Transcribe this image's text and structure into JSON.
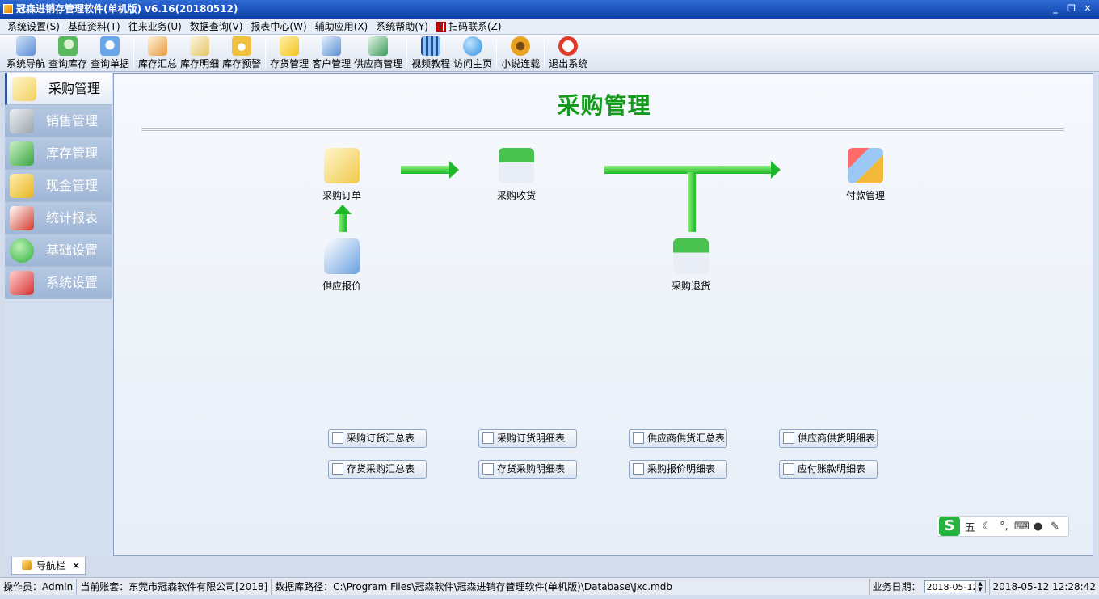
{
  "window": {
    "title": "冠森进销存管理软件(单机版) v6.16(20180512)"
  },
  "menu": [
    "系统设置(S)",
    "基础资料(T)",
    "往来业务(U)",
    "数据查询(V)",
    "报表中心(W)",
    "辅助应用(X)",
    "系统帮助(Y)",
    "扫码联系(Z)"
  ],
  "toolbar": [
    {
      "label": "系统导航",
      "icon": "computer-icon",
      "color": "#5b8fd9"
    },
    {
      "label": "查询库存",
      "icon": "magnifier-icon",
      "color": "#58b85c"
    },
    {
      "label": "查询单据",
      "icon": "search-doc-icon",
      "color": "#6aa6e8"
    },
    {
      "label": "库存汇总",
      "icon": "chart-doc-icon",
      "color": "#e89a3a"
    },
    {
      "label": "库存明细",
      "icon": "files-icon",
      "color": "#e3c36b"
    },
    {
      "label": "库存预警",
      "icon": "alarm-doc-icon",
      "color": "#f0c040"
    },
    {
      "label": "存货管理",
      "icon": "box-icon",
      "color": "#f3c21f"
    },
    {
      "label": "客户管理",
      "icon": "customer-card-icon",
      "color": "#5a8fd0"
    },
    {
      "label": "供应商管理",
      "icon": "supplier-card-icon",
      "color": "#3b9a5a"
    },
    {
      "label": "视频教程",
      "icon": "film-icon",
      "color": "#3a7fd4"
    },
    {
      "label": "访问主页",
      "icon": "globe-icon",
      "color": "#2f8fe0"
    },
    {
      "label": "小说连载",
      "icon": "sunflower-icon",
      "color": "#e9a21f"
    },
    {
      "label": "退出系统",
      "icon": "stop-icon",
      "color": "#e23a2a"
    }
  ],
  "sidebar": [
    {
      "label": "采购管理",
      "icon": "shopping-bag-icon",
      "color": "#f2d060",
      "active": true
    },
    {
      "label": "销售管理",
      "icon": "cash-register-icon",
      "color": "#9aa4ad",
      "active": false
    },
    {
      "label": "库存管理",
      "icon": "house-icon",
      "color": "#3aa53f",
      "active": false
    },
    {
      "label": "现金管理",
      "icon": "coins-icon",
      "color": "#e8b420",
      "active": false
    },
    {
      "label": "统计报表",
      "icon": "report-chart-icon",
      "color": "#d33a2a",
      "active": false
    },
    {
      "label": "基础设置",
      "icon": "check-icon",
      "color": "#2fae3a",
      "active": false
    },
    {
      "label": "系统设置",
      "icon": "wrench-icon",
      "color": "#d83030",
      "active": false
    }
  ],
  "main": {
    "title": "采购管理",
    "nodes": [
      {
        "label": "采购订单",
        "icon": "order-bag-icon",
        "color": "#f0c84a"
      },
      {
        "label": "采购收货",
        "icon": "receive-house-icon",
        "color": "#35a83c"
      },
      {
        "label": "付款管理",
        "icon": "payment-card-icon",
        "color": "#f2b93a"
      },
      {
        "label": "供应报价",
        "icon": "quote-doc-icon",
        "color": "#6aa0e0"
      },
      {
        "label": "采购退货",
        "icon": "return-house-icon",
        "color": "#35a83c"
      }
    ],
    "reports": [
      "采购订货汇总表",
      "采购订货明细表",
      "供应商供货汇总表",
      "供应商供货明细表",
      "存货采购汇总表",
      "存货采购明细表",
      "采购报价明细表",
      "应付账款明细表"
    ]
  },
  "ime": {
    "mode": "五"
  },
  "tab": {
    "label": "导航栏",
    "close": "✕"
  },
  "status": {
    "operator": "操作员：Admin",
    "account": "当前账套：东莞市冠森软件有限公司[2018]",
    "dbpath": "数据库路径：C:\\Program Files\\冠森软件\\冠森进销存管理软件(单机版)\\Database\\Jxc.mdb",
    "date_label": "业务日期：",
    "date_value": "2018-05-12",
    "datetime": "2018-05-12 12:28:42"
  }
}
